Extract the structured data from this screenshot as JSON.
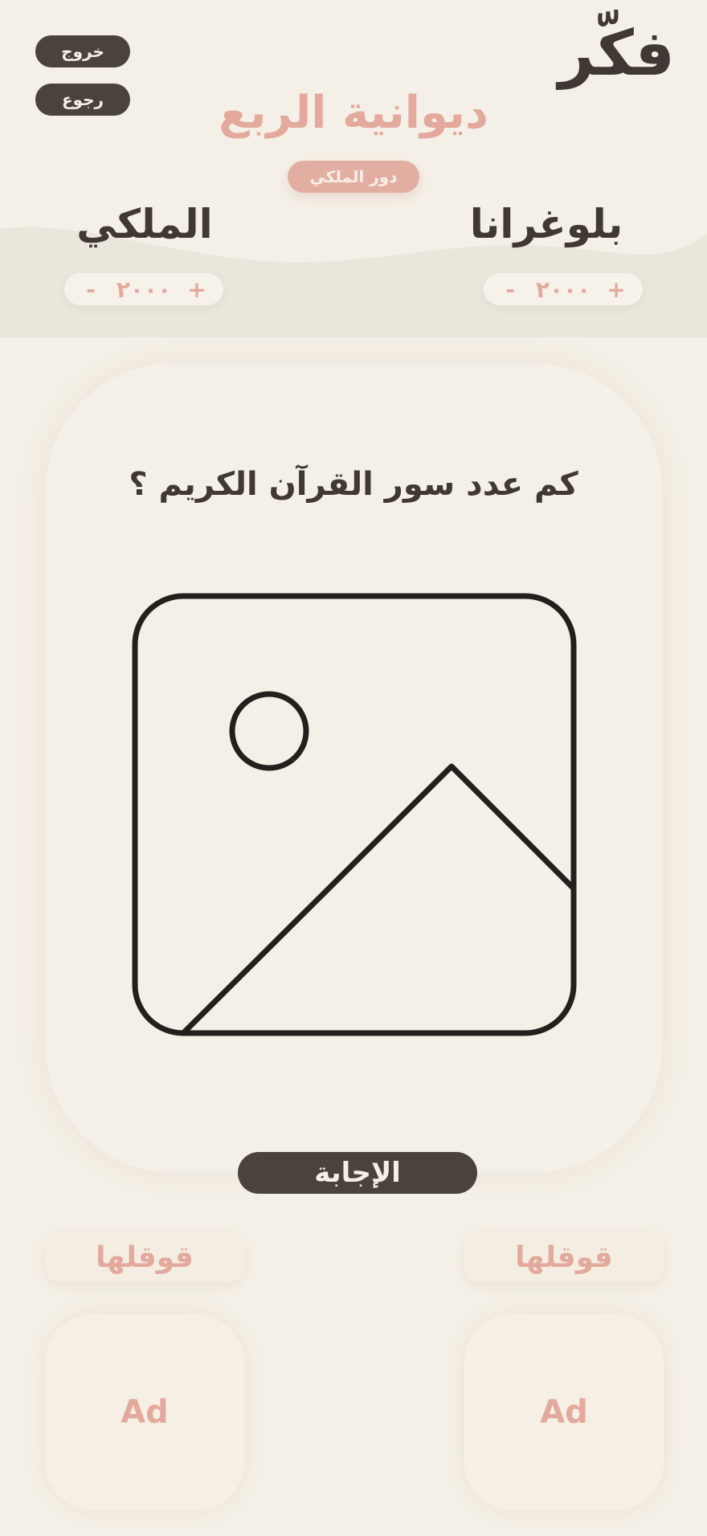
{
  "app": {
    "logo_text": "فكّر"
  },
  "header": {
    "exit_label": "خروج",
    "back_label": "رجوع"
  },
  "game": {
    "title": "ديوانية الربع",
    "turn_label": "دور الملكي"
  },
  "teams": [
    {
      "name": "بلوغرانا",
      "score": "٢٠٠٠",
      "plus_label": "+",
      "minus_label": "-"
    },
    {
      "name": "الملكي",
      "score": "٢٠٠٠",
      "plus_label": "+",
      "minus_label": "-"
    }
  ],
  "question": {
    "text": "كم عدد سور القرآن الكريم ؟"
  },
  "actions": {
    "answer_label": "الإجابة",
    "stop_left_label": "قوقلها",
    "stop_right_label": "قوقلها"
  },
  "ads": {
    "left_label": "Ad",
    "right_label": "Ad"
  },
  "colors": {
    "background": "#f5f0e7",
    "wave": "#ebe6dc",
    "dark": "#4a423d",
    "accent": "#e3a99c"
  }
}
